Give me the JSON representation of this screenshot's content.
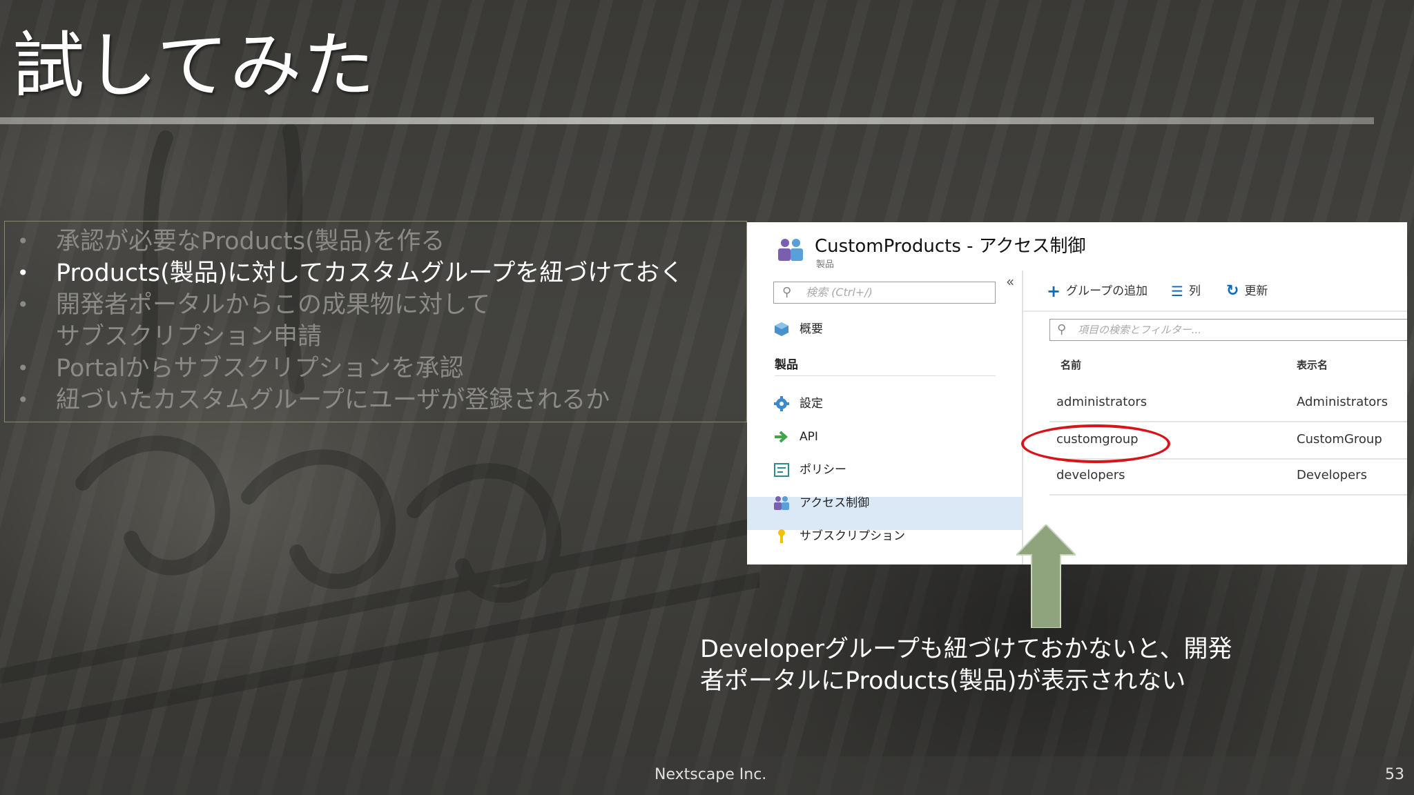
{
  "slide": {
    "title": "試してみた",
    "bullets": [
      {
        "text": "承認が必要なProducts(製品)を作る",
        "active": false
      },
      {
        "text": "Products(製品)に対してカスタムグループを紐づけておく",
        "active": true
      },
      {
        "text": "開発者ポータルからこの成果物に対して",
        "active": false
      },
      {
        "text": "サブスクリプション申請",
        "active": false,
        "continuation": true
      },
      {
        "text": "Portalからサブスクリプションを承認",
        "active": false
      },
      {
        "text": "紐づいたカスタムグループにユーザが登録されるか",
        "active": false
      }
    ],
    "note_line1": "Developerグループも紐づけておかないと、開発",
    "note_line2": "者ポータルにProducts(製品)が表示されない",
    "footer_company": "Nextscape Inc.",
    "page_number": "53"
  },
  "screenshot": {
    "header": {
      "title": "CustomProducts - アクセス制御",
      "subtitle": "製品",
      "icon": "people-group-icon"
    },
    "left_pane": {
      "collapse_glyph": "«",
      "search_placeholder": "検索 (Ctrl+/)",
      "overview_label": "概要",
      "section_label": "製品",
      "items": [
        {
          "label": "設定",
          "icon": "gear-icon"
        },
        {
          "label": "API",
          "icon": "api-arrow-icon"
        },
        {
          "label": "ポリシー",
          "icon": "policy-icon"
        },
        {
          "label": "アクセス制御",
          "icon": "people-group-icon",
          "selected": true
        },
        {
          "label": "サブスクリプション",
          "icon": "key-icon"
        }
      ]
    },
    "toolbar": {
      "add_group": "グループの追加",
      "columns": "列",
      "refresh": "更新"
    },
    "filter_placeholder": "項目の検索とフィルター...",
    "table": {
      "headers": [
        "名前",
        "表示名"
      ],
      "rows": [
        {
          "name": "administrators",
          "display": "Administrators"
        },
        {
          "name": "customgroup",
          "display": "CustomGroup"
        },
        {
          "name": "developers",
          "display": "Developers"
        }
      ]
    }
  },
  "colors": {
    "accent_blue": "#0a6ac0",
    "highlight_red": "#d8141b",
    "arrow_green": "#8fa47c",
    "selected_row": "#dbe9f7"
  }
}
